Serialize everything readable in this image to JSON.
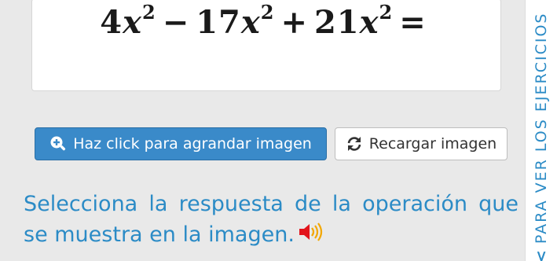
{
  "exercise": {
    "equation_terms": [
      {
        "coef": "4",
        "var": "x",
        "exp": "2"
      },
      {
        "op": "−"
      },
      {
        "coef": "17",
        "var": "x",
        "exp": "2"
      },
      {
        "op": "+"
      },
      {
        "coef": "21",
        "var": "x",
        "exp": "2"
      },
      {
        "op": "="
      }
    ]
  },
  "buttons": {
    "enlarge_label": "Haz click para agrandar imagen",
    "enlarge_icon": "zoom-in-icon",
    "reload_label": "Recargar imagen",
    "reload_icon": "refresh-icon"
  },
  "instruction": {
    "text": "Selecciona la respuesta de la operación que se muestra en la imagen.",
    "audio_icon": "speaker-icon"
  },
  "side_tab": {
    "label": "PARA VER LOS EJERCICIOS",
    "chevron": "<",
    "icon": "chevron-left-icon"
  },
  "colors": {
    "accent": "#2b8bc6",
    "primary_button": "#3a8ac9",
    "background": "#e9e9e9"
  }
}
